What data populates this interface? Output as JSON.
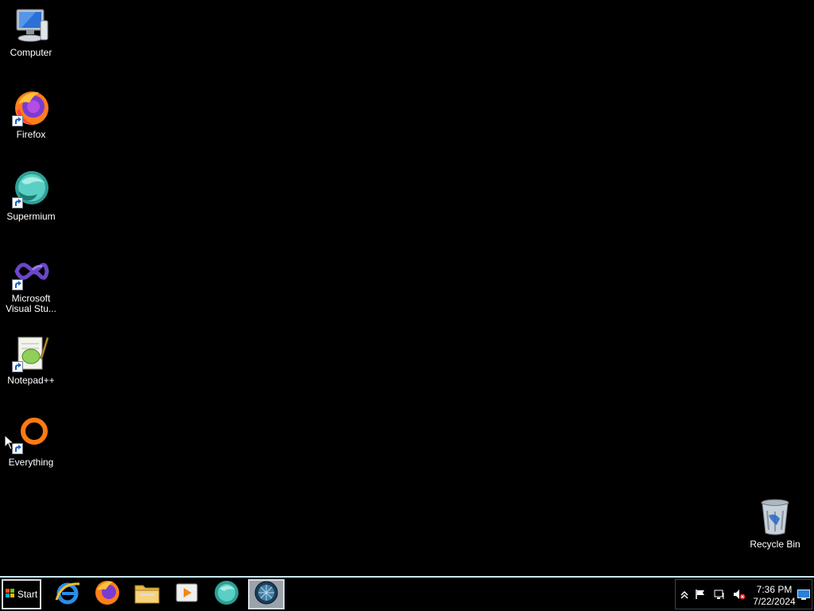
{
  "desktop": {
    "icons": [
      {
        "label": "Computer",
        "icon": "computer-icon"
      },
      {
        "label": "Firefox",
        "icon": "firefox-icon"
      },
      {
        "label": "Supermium",
        "icon": "supermium-icon"
      },
      {
        "label": "Microsoft\nVisual Stu...",
        "icon": "visual-studio-icon"
      },
      {
        "label": "Notepad++",
        "icon": "notepadpp-icon"
      },
      {
        "label": "Everything",
        "icon": "everything-icon"
      }
    ],
    "recycle_bin": {
      "label": "Recycle Bin",
      "icon": "recycle-bin-icon"
    }
  },
  "taskbar": {
    "start_label": "Start",
    "pinned": [
      {
        "icon": "internet-explorer-icon"
      },
      {
        "icon": "firefox-icon"
      },
      {
        "icon": "file-explorer-icon"
      },
      {
        "icon": "media-player-icon"
      },
      {
        "icon": "supermium-icon"
      },
      {
        "icon": "network-globe-icon",
        "active": true
      }
    ],
    "tray": {
      "icons": [
        "show-hidden-icon",
        "action-center-flag-icon",
        "network-icon",
        "volume-muted-icon"
      ],
      "time": "7:36 PM",
      "date": "7/22/2024"
    }
  }
}
